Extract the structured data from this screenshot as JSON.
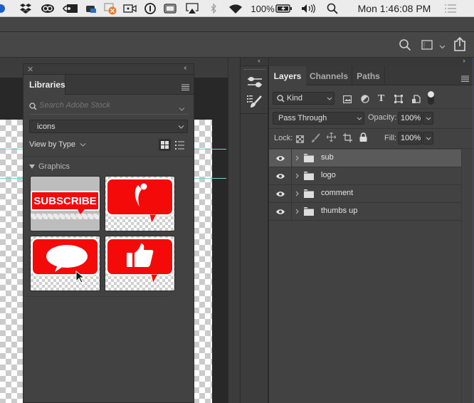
{
  "menubar": {
    "status_icons": [
      "dropbox-icon",
      "creative-cloud-icon",
      "nvidia-icon",
      "printer-icon",
      "notification-icon",
      "video-camera-icon",
      "one-password-icon",
      "display-icon",
      "airplay-icon",
      "bluetooth-icon",
      "wifi-icon"
    ],
    "battery_percent": "100%",
    "clock": "Mon 1:46:08 PM"
  },
  "libraries": {
    "tab_label": "Libraries",
    "search_placeholder": "Search Adobe Stock",
    "library_select": "icons",
    "view_label": "View by Type",
    "section_label": "Graphics",
    "items": [
      {
        "name": "subscribe",
        "text": "SUBSCRIBE"
      },
      {
        "name": "logo",
        "text": ""
      },
      {
        "name": "comment",
        "text": ""
      },
      {
        "name": "thumbs-up",
        "text": ""
      }
    ]
  },
  "layers_panel": {
    "tabs": [
      "Layers",
      "Channels",
      "Paths"
    ],
    "active_tab": "Layers",
    "filter_kind": "Kind",
    "blend_mode": "Pass Through",
    "opacity_label": "Opacity:",
    "opacity_value": "100%",
    "lock_label": "Lock:",
    "fill_label": "Fill:",
    "fill_value": "100%",
    "layers": [
      {
        "name": "sub",
        "selected": true
      },
      {
        "name": "logo",
        "selected": false
      },
      {
        "name": "comment",
        "selected": false
      },
      {
        "name": "thumbs up",
        "selected": false
      }
    ]
  },
  "colors": {
    "accent_red": "#f50a0a",
    "guide_cyan": "#6fd6d6",
    "panel_bg": "#424242"
  }
}
